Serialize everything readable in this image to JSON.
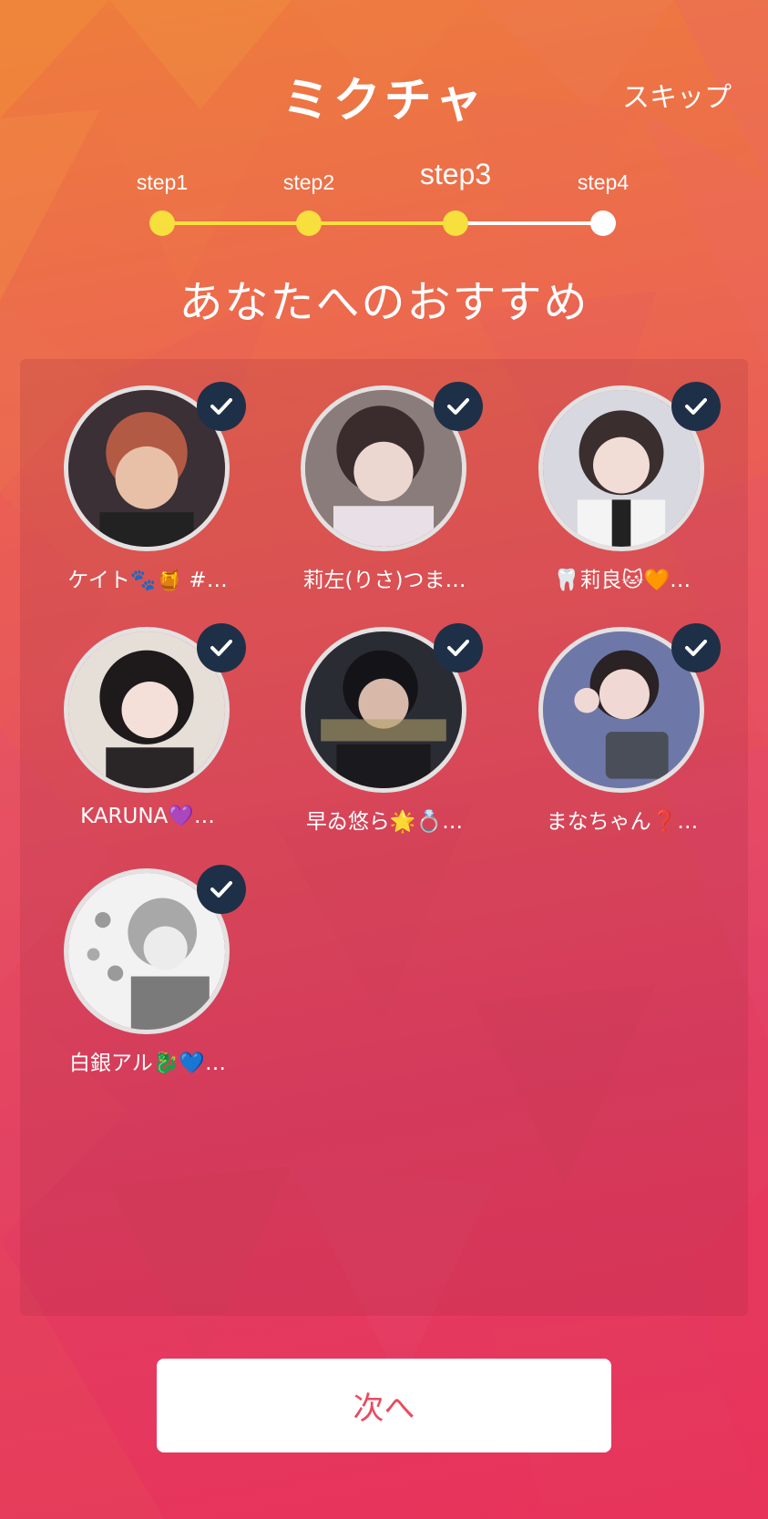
{
  "app": {
    "logo_text": "ミクチャ",
    "skip_label": "スキップ"
  },
  "steps": {
    "items": [
      {
        "label": "step1",
        "state": "done"
      },
      {
        "label": "step2",
        "state": "done"
      },
      {
        "label": "step3",
        "state": "current"
      },
      {
        "label": "step4",
        "state": "todo"
      }
    ],
    "done_color": "#f7df3e",
    "todo_color": "#ffffff"
  },
  "title": "あなたへのおすすめ",
  "recommendations": [
    {
      "name": "ケイト🐾🍯 #…",
      "checked": true,
      "avatar_colors": [
        "#3a3036",
        "#b35a45"
      ]
    },
    {
      "name": "莉左(りさ)つま…",
      "checked": true,
      "avatar_colors": [
        "#5a4a4a",
        "#e8d8d8"
      ]
    },
    {
      "name": "🦷莉良🐱🧡…",
      "checked": true,
      "avatar_colors": [
        "#d8d8e0",
        "#3a2e2e"
      ]
    },
    {
      "name": "KARUNA💜…",
      "checked": true,
      "avatar_colors": [
        "#e6dfd8",
        "#1e1a1c"
      ]
    },
    {
      "name": "早ゐ悠ら🌟💍…",
      "checked": true,
      "avatar_colors": [
        "#2a2c34",
        "#b0a06a"
      ]
    },
    {
      "name": "まなちゃん❓…",
      "checked": true,
      "avatar_colors": [
        "#6d78a8",
        "#e8d2d0"
      ]
    },
    {
      "name": "白銀アル🐉💙…",
      "checked": true,
      "avatar_colors": [
        "#f0f0f0",
        "#8a8a8a"
      ]
    }
  ],
  "next_button_label": "次へ",
  "colors": {
    "check_badge": "#1e3047",
    "next_text": "#ea4a5e"
  }
}
